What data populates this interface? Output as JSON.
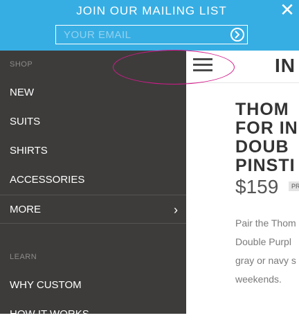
{
  "banner": {
    "title": "JOIN OUR MAILING LIST",
    "email_placeholder": "YOUR EMAIL",
    "color": "#37aee3"
  },
  "sidebar": {
    "section_shop": "SHOP",
    "items_shop": [
      {
        "label": "NEW"
      },
      {
        "label": "SUITS"
      },
      {
        "label": "SHIRTS"
      },
      {
        "label": "ACCESSORIES"
      }
    ],
    "more_label": "MORE",
    "section_learn": "LEARN",
    "items_learn": [
      {
        "label": "WHY CUSTOM"
      },
      {
        "label": "HOW IT WORKS"
      }
    ],
    "background": "#3d3c3b"
  },
  "main": {
    "logo_text": "IN",
    "product": {
      "title_lines": [
        "THOM",
        "FOR IN",
        "DOUB",
        "PINSTI"
      ],
      "price": "$159",
      "price_badge": "PR",
      "description_lines": [
        "Pair the Thom",
        "Double Purpl",
        "gray or navy s",
        "weekends."
      ]
    }
  },
  "icons": {
    "close": "close-icon",
    "submit": "arrow-right-circle-icon",
    "menu": "hamburger-menu-icon",
    "more": "chevron-right-icon"
  }
}
